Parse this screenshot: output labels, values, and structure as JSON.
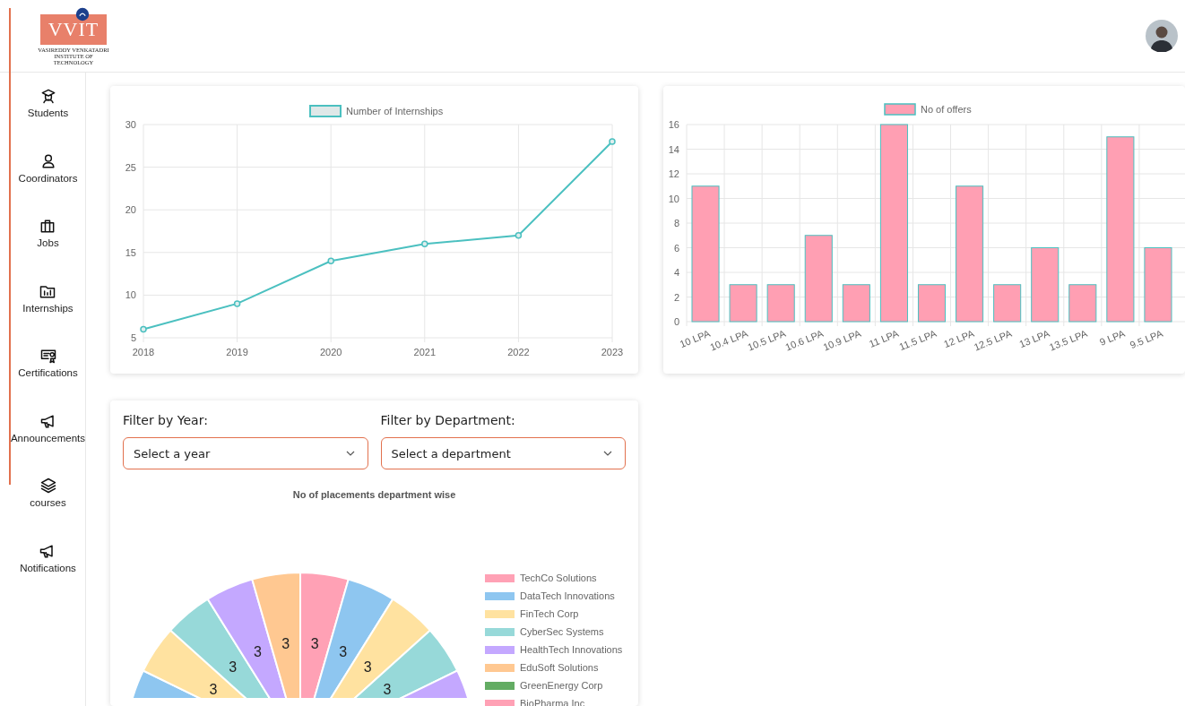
{
  "logo": {
    "text": "VVIT",
    "subtitle": "VASIREDDY VENKATADRI INSTITUTE OF TECHNOLOGY"
  },
  "sidebar": {
    "items": [
      {
        "label": "Students"
      },
      {
        "label": "Coordinators"
      },
      {
        "label": "Jobs"
      },
      {
        "label": "Internships"
      },
      {
        "label": "Certifications"
      },
      {
        "label": "Announcements"
      },
      {
        "label": "courses"
      },
      {
        "label": "Notifications"
      }
    ]
  },
  "internships_chart": {
    "chart_data": {
      "type": "line",
      "x": [
        "2018",
        "2019",
        "2020",
        "2021",
        "2022",
        "2023"
      ],
      "series": [
        {
          "name": "Number of Internships",
          "color": "#4bc0c0",
          "marker": "circle",
          "values": [
            6,
            9,
            14,
            16,
            17,
            28
          ]
        }
      ],
      "ylim": [
        5,
        30
      ],
      "yticks": [
        5,
        10,
        15,
        20,
        25,
        30
      ],
      "grid": true,
      "legend": "top"
    }
  },
  "offers_chart": {
    "chart_data": {
      "type": "bar",
      "categories": [
        "10 LPA",
        "10.4 LPA",
        "10.5 LPA",
        "10.6 LPA",
        "10.9 LPA",
        "11 LPA",
        "11.5 LPA",
        "12 LPA",
        "12.5 LPA",
        "13 LPA",
        "13.5 LPA",
        "9 LPA",
        "9.5 LPA"
      ],
      "series": [
        {
          "name": "No of offers",
          "color": "#ff9fb3",
          "values": [
            11,
            3,
            3,
            7,
            3,
            16,
            3,
            11,
            3,
            6,
            3,
            15,
            6
          ]
        }
      ],
      "ylim": [
        0,
        16
      ],
      "yticks": [
        0,
        2,
        4,
        6,
        8,
        10,
        12,
        14,
        16
      ],
      "grid": true,
      "legend": "top"
    }
  },
  "filters": [
    {
      "label": "Filter by Year:",
      "placeholder": "Select a year"
    },
    {
      "label": "Filter by Department:",
      "placeholder": "Select a department"
    }
  ],
  "placements_chart": {
    "title": "No of placements department wise",
    "slice_labels": [
      "3",
      "3",
      "3",
      "3",
      "3",
      "3",
      "3",
      "3"
    ],
    "legend": [
      {
        "label": "TechCo Solutions",
        "color": "#ffa1b5"
      },
      {
        "label": "DataTech Innovations",
        "color": "#8ec6f0"
      },
      {
        "label": "FinTech Corp",
        "color": "#ffe2a0"
      },
      {
        "label": "CyberSec Systems",
        "color": "#97d9d9"
      },
      {
        "label": "HealthTech Innovations",
        "color": "#c4a8ff"
      },
      {
        "label": "EduSoft Solutions",
        "color": "#ffc891"
      },
      {
        "label": "GreenEnergy Corp",
        "color": "#63ac63"
      },
      {
        "label": "BioPharma Inc",
        "color": "#ffa1b5"
      }
    ]
  }
}
